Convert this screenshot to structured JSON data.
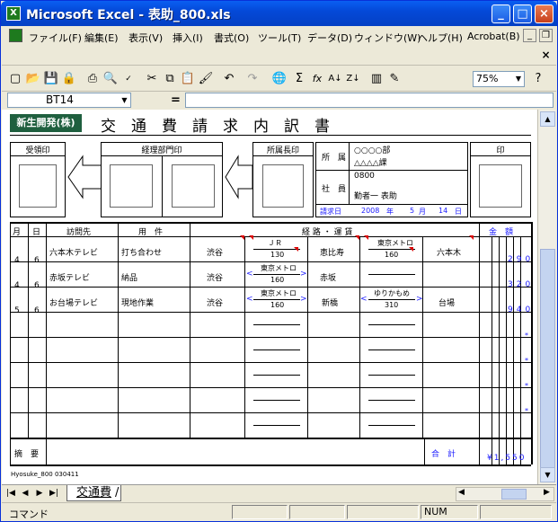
{
  "window": {
    "title": "Microsoft Excel - 表助_800.xls",
    "app_icon": "excel-icon",
    "buttons": {
      "minimize": "_",
      "maximize": "□",
      "close": "×"
    }
  },
  "menu": {
    "items": [
      "ファイル(F)",
      "編集(E)",
      "表示(V)",
      "挿入(I)",
      "書式(O)",
      "ツール(T)",
      "データ(D)",
      "ウィンドウ(W)",
      "ヘルプ(H)",
      "Acrobat(B)"
    ],
    "doc_buttons": {
      "minimize": "_",
      "restore": "❐",
      "close": "×"
    }
  },
  "toolbar": {
    "icons": [
      "new-icon",
      "open-icon",
      "save-icon",
      "permission-icon",
      "print-icon",
      "print-preview-icon",
      "spelling-icon",
      "cut-icon",
      "copy-icon",
      "paste-icon",
      "format-painter-icon",
      "undo-icon",
      "redo-icon",
      "hyperlink-icon",
      "autosum-icon",
      "function-icon",
      "sort-asc-icon",
      "sort-desc-icon",
      "chart-wizard-icon",
      "drawing-icon",
      "help-icon"
    ],
    "zoom": "75%"
  },
  "formula_bar": {
    "name_box": "BT14",
    "equals": "=",
    "value": ""
  },
  "form": {
    "company": "新生開発(株)",
    "title": "交　通　費　請　求　内　訳　書",
    "stamps": {
      "received": "受領印",
      "accounting": "経理部門印",
      "manager": "所属長印",
      "seal": "印"
    },
    "department_label": "所　属",
    "department_lines": [
      "○○○○部",
      "△△△△課"
    ],
    "employee_label": "社　員",
    "employee_number": "0800",
    "employee_name": "勤者一 表助",
    "request_date_label": "請求日",
    "request_date": {
      "year": "2008",
      "year_unit": "年",
      "month": "5",
      "month_unit": "月",
      "day": "14",
      "day_unit": "日"
    },
    "headers": {
      "month": "月",
      "day": "日",
      "visit": "訪問先",
      "purpose": "用　件",
      "route": "経 路 ・ 運 賃",
      "amount": "金　額"
    },
    "rows": [
      {
        "month": "4",
        "day": "6",
        "visit": "六本木テレビ",
        "purpose": "打ち合わせ",
        "stations": [
          "渋谷",
          "恵比寿",
          "六本木"
        ],
        "fares": [
          {
            "line": "ＪＲ",
            "fare": "130",
            "arrows": false
          },
          {
            "line": "東京メトロ",
            "fare": "160",
            "arrows": false
          }
        ],
        "amount": "290"
      },
      {
        "month": "4",
        "day": "6",
        "visit": "赤坂テレビ",
        "purpose": "納品",
        "stations": [
          "渋谷",
          "赤坂",
          ""
        ],
        "fares": [
          {
            "line": "東京メトロ",
            "fare": "160",
            "arrows": true
          },
          {
            "line": "",
            "fare": "",
            "arrows": false
          }
        ],
        "amount": "320"
      },
      {
        "month": "5",
        "day": "6",
        "visit": "お台場テレビ",
        "purpose": "現地作業",
        "stations": [
          "渋谷",
          "新橋",
          "台場"
        ],
        "fares": [
          {
            "line": "東京メトロ",
            "fare": "160",
            "arrows": true
          },
          {
            "line": "ゆりかもめ",
            "fare": "310",
            "arrows": true
          }
        ],
        "amount": "940"
      }
    ],
    "empty_row_mark": "*",
    "remarks_label": "摘　要",
    "total_label": "合　計",
    "total_amount": "¥1,550",
    "footer_id": "Hyosuke_800 030411"
  },
  "sheet_tabs": {
    "nav": [
      "|◀",
      "◀",
      "▶",
      "▶|"
    ],
    "active": "交通費",
    "separator": "/"
  },
  "status": {
    "mode": "コマンド",
    "num": "NUM"
  }
}
